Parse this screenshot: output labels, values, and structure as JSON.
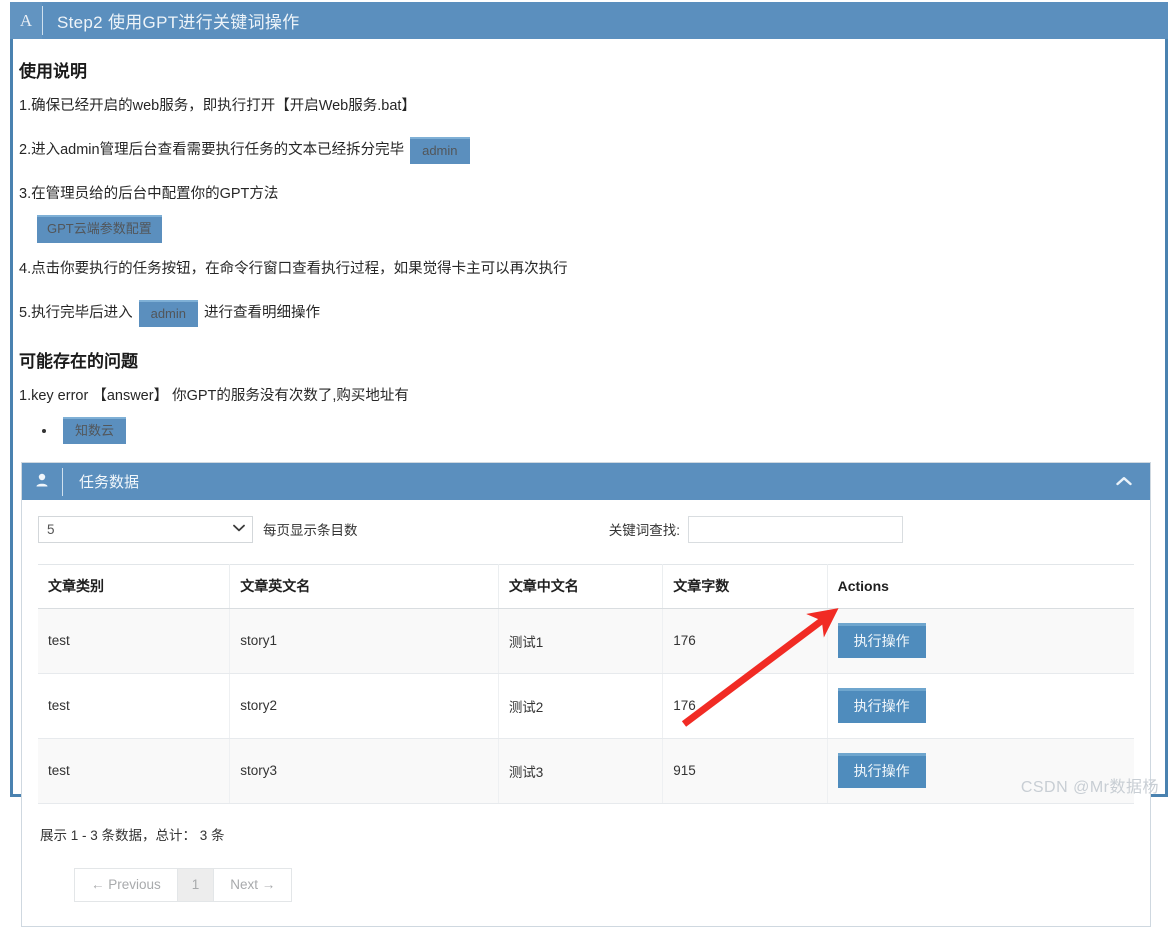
{
  "titlebar": {
    "logo": "A",
    "title": "Step2 使用GPT进行关键词操作"
  },
  "instructions": {
    "heading": "使用说明",
    "step1": "1.确保已经开启的web服务，即执行打开【开启Web服务.bat】",
    "step2": "2.进入admin管理后台查看需要执行任务的文本已经拆分完毕",
    "step2_badge": "admin",
    "step3": "3.在管理员给的后台中配置你的GPT方法",
    "step3_badge": "GPT云端参数配置",
    "step4": "4.点击你要执行的任务按钮，在命令行窗口查看执行过程，如果觉得卡主可以再次执行",
    "step5_a": "5.执行完毕后进入",
    "step5_badge": "admin",
    "step5_b": "进行查看明细操作"
  },
  "problems": {
    "heading": "可能存在的问题",
    "item1": "1.key error 【answer】 你GPT的服务没有次数了,购买地址有",
    "link_badge": "知数云"
  },
  "panel": {
    "icon": "user-icon",
    "title": "任务数据",
    "collapse_icon": "chevron-up-icon",
    "length_value": "5",
    "length_label": "每页显示条目数",
    "filter_label": "关键词查找:",
    "filter_value": "",
    "filter_placeholder": ""
  },
  "table": {
    "columns": [
      "文章类别",
      "文章英文名",
      "文章中文名",
      "文章字数",
      "Actions"
    ],
    "rows": [
      {
        "category": "test",
        "en_name": "story1",
        "cn_name": "测试1",
        "words": "176",
        "action": "执行操作"
      },
      {
        "category": "test",
        "en_name": "story2",
        "cn_name": "测试2",
        "words": "176",
        "action": "执行操作"
      },
      {
        "category": "test",
        "en_name": "story3",
        "cn_name": "测试3",
        "words": "915",
        "action": "执行操作"
      }
    ],
    "info": "展示 1 - 3 条数据，总计： 3 条",
    "pagination": {
      "previous": "← Previous",
      "page1": "1",
      "next": "Next →"
    }
  },
  "watermark": "CSDN @Mr数据杨",
  "colors": {
    "accent_blue": "#5b8fbe",
    "button_blue": "#4f8cbd",
    "annotation_red": "#f12b24"
  }
}
